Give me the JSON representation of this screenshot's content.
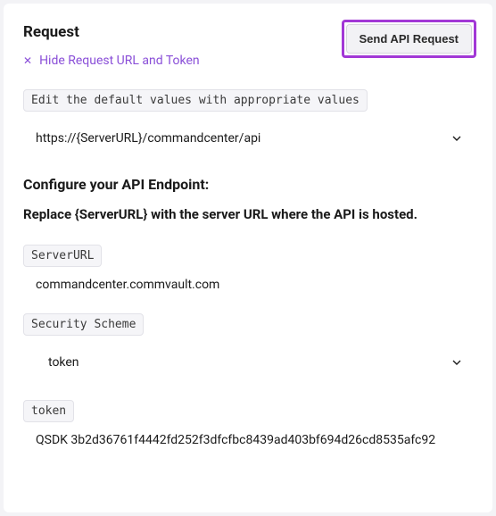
{
  "header": {
    "title": "Request",
    "send_button_label": "Send API Request"
  },
  "hide_link": {
    "label": "Hide Request URL and Token"
  },
  "edit_hint": {
    "label": "Edit the default values with appropriate values"
  },
  "url_dropdown": {
    "value": "https://{ServerURL}/commandcenter/api"
  },
  "configure": {
    "heading": "Configure your API Endpoint:",
    "instruction": "Replace {ServerURL} with the server URL where the API is hosted."
  },
  "server_url": {
    "label": "ServerURL",
    "value": "commandcenter.commvault.com"
  },
  "security_scheme": {
    "label": "Security Scheme",
    "value": "token"
  },
  "token": {
    "label": "token",
    "value": "QSDK 3b2d36761f4442fd252f3dfcfbc8439ad403bf694d26cd8535afc92"
  }
}
